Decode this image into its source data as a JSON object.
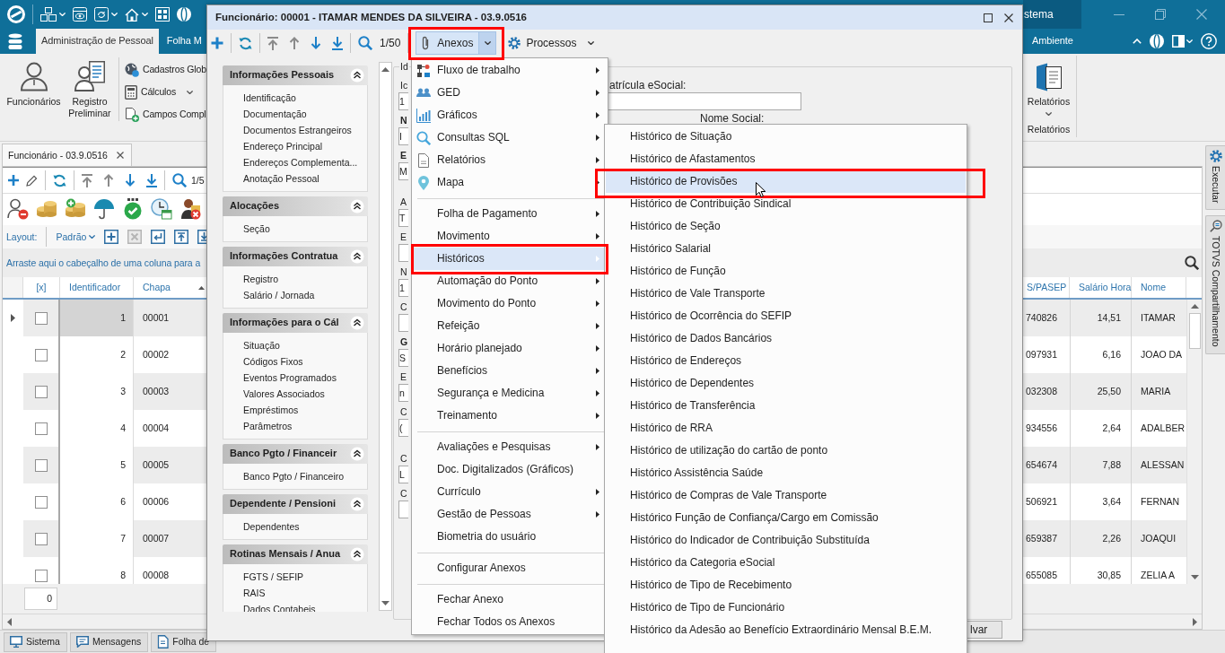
{
  "app_bar": {
    "title": "stema"
  },
  "ribbon": {
    "tabs": [
      {
        "label": "Administração de Pessoal",
        "selected": true
      },
      {
        "label": "Folha M",
        "selected": false
      },
      {
        "label": "Ambiente",
        "selected": false
      }
    ],
    "large_buttons": [
      {
        "label": "Funcionários"
      },
      {
        "label": "Registro Preliminar"
      }
    ],
    "small_buttons": [
      {
        "label": "Cadastros Glob"
      },
      {
        "label": "Cálculos",
        "dropdown": true
      },
      {
        "label": "Campos Compl"
      }
    ],
    "report_button": {
      "label": "Relatórios",
      "dropdown": true
    },
    "report_group": "Relatórios"
  },
  "document_tab": {
    "label": "Funcionário - 03.9.0516",
    "closable": true
  },
  "toolbar": {
    "position": "1/5"
  },
  "layout_bar": {
    "label": "Layout:",
    "value": "Padrão"
  },
  "group_hint": "Arraste aqui o cabeçalho de uma coluna para a",
  "grid": {
    "check_column": {
      "label": "[x]"
    },
    "columns": [
      {
        "label": "Identificador",
        "kind": "number",
        "sorted": false
      },
      {
        "label": "Chapa",
        "kind": "text",
        "sorted": true
      },
      {
        "label": "S/PASEP",
        "kind": "number",
        "sorted": false
      },
      {
        "label": "Salário Hora",
        "kind": "number",
        "sorted": false
      },
      {
        "label": "Nome",
        "kind": "text",
        "sorted": false
      }
    ],
    "rows": [
      {
        "selected": true,
        "checked": false,
        "cells": [
          "1",
          "00001",
          "740826",
          "14,51",
          "ITAMAR"
        ]
      },
      {
        "selected": false,
        "checked": false,
        "cells": [
          "2",
          "00002",
          "097931",
          "6,16",
          "JOAO DA"
        ]
      },
      {
        "selected": false,
        "checked": false,
        "cells": [
          "3",
          "00003",
          "032308",
          "25,50",
          "MARIA"
        ]
      },
      {
        "selected": false,
        "checked": false,
        "cells": [
          "4",
          "00004",
          "934556",
          "2,64",
          "ADALBER"
        ]
      },
      {
        "selected": false,
        "checked": false,
        "cells": [
          "5",
          "00005",
          "654674",
          "7,88",
          "ALESSAN"
        ]
      },
      {
        "selected": false,
        "checked": false,
        "cells": [
          "6",
          "00006",
          "506921",
          "3,64",
          "FERNAN"
        ]
      },
      {
        "selected": false,
        "checked": false,
        "cells": [
          "7",
          "00007",
          "659387",
          "2,26",
          "JOAQUI"
        ]
      },
      {
        "selected": false,
        "checked": false,
        "cells": [
          "8",
          "00008",
          "655085",
          "30,85",
          "ZELIA A"
        ]
      }
    ]
  },
  "grid_footer": {
    "count": "0"
  },
  "side_tabs": [
    {
      "label": "Executar"
    },
    {
      "label": "TOTVS Compartilhamento"
    }
  ],
  "taskbar": [
    {
      "label": "Sistema"
    },
    {
      "label": "Mensagens"
    },
    {
      "label": "Folha de"
    }
  ],
  "dialog": {
    "title": "Funcionário: 00001 - ITAMAR MENDES DA SILVEIRA - 03.9.0516",
    "position": "1/50",
    "menu_buttons": [
      {
        "label": "Anexos",
        "open": true,
        "framed": true
      },
      {
        "label": "Processos",
        "open": false,
        "framed": false
      }
    ],
    "sections": [
      {
        "title": "Informações Pessoais",
        "expanded": true,
        "links": [
          "Identificação",
          "Documentação",
          "Documentos Estrangeiros",
          "Endereço Principal",
          "Endereços Complementa...",
          "Anotação Pessoal"
        ]
      },
      {
        "title": "Alocações",
        "expanded": true,
        "links": [
          "Seção"
        ]
      },
      {
        "title": "Informações Contratua",
        "expanded": true,
        "links": [
          "Registro",
          "Salário / Jornada"
        ]
      },
      {
        "title": "Informações para o Cál",
        "expanded": true,
        "links": [
          "Situação",
          "Códigos Fixos",
          "Eventos Programados",
          "Valores Associados",
          "Empréstimos",
          "Parâmetros"
        ]
      },
      {
        "title": "Banco Pgto / Financeir",
        "expanded": true,
        "links": [
          "Banco Pgto / Financeiro"
        ]
      },
      {
        "title": "Dependente / Pensioni",
        "expanded": true,
        "links": [
          "Dependentes"
        ]
      },
      {
        "title": "Rotinas Mensais / Anua",
        "expanded": true,
        "links": [
          "FGTS / SEFIP",
          "RAIS",
          "Dados Contabeis"
        ]
      }
    ],
    "form": {
      "legend": "Id",
      "field_groups": [
        [
          {
            "label": "Ic",
            "value": "1",
            "required": false
          },
          {
            "label": "N",
            "value": "I",
            "required": true
          },
          {
            "label": "E",
            "value": "M",
            "required": true
          }
        ],
        [
          {
            "label": "A",
            "value": "T",
            "required": false
          },
          {
            "label": "E",
            "required": false
          },
          {
            "label": "N",
            "value": "1",
            "required": false
          },
          {
            "label": "C",
            "required": false
          },
          {
            "label": "G",
            "value": "S",
            "required": true
          },
          {
            "label": "E",
            "value": "n",
            "required": false
          },
          {
            "label": "C",
            "value": "(",
            "required": false
          }
        ],
        [
          {
            "label": "C",
            "value": "L",
            "required": false
          },
          {
            "label": "C",
            "required": false
          }
        ]
      ],
      "esocial_label": "atrícula eSocial:",
      "social_name_label": "Nome Social:"
    },
    "save_button": "lvar"
  },
  "attachments_menu": {
    "items": [
      {
        "kind": "icon_item",
        "label": "Fluxo de trabalho",
        "submenu": true,
        "selected": false,
        "framed": false
      },
      {
        "kind": "icon_item",
        "label": "GED",
        "submenu": true,
        "selected": false,
        "framed": false
      },
      {
        "kind": "icon_item",
        "label": "Gráficos",
        "submenu": true,
        "selected": false,
        "framed": false
      },
      {
        "kind": "icon_item",
        "label": "Consultas SQL",
        "submenu": true,
        "selected": false,
        "framed": false
      },
      {
        "kind": "icon_item",
        "label": "Relatórios",
        "submenu": true,
        "selected": false,
        "framed": false
      },
      {
        "kind": "icon_item",
        "label": "Mapa",
        "submenu": true,
        "selected": false,
        "framed": false
      },
      {
        "kind": "separator"
      },
      {
        "kind": "item",
        "label": "Folha de Pagamento",
        "submenu": true,
        "selected": false,
        "framed": false
      },
      {
        "kind": "item",
        "label": "Movimento",
        "submenu": true,
        "selected": false,
        "framed": false
      },
      {
        "kind": "item",
        "label": "Históricos",
        "submenu": true,
        "selected": true,
        "framed": true
      },
      {
        "kind": "item",
        "label": "Automação do Ponto",
        "submenu": true,
        "selected": false,
        "framed": false
      },
      {
        "kind": "item",
        "label": "Movimento do Ponto",
        "submenu": true,
        "selected": false,
        "framed": false
      },
      {
        "kind": "item",
        "label": "Refeição",
        "submenu": true,
        "selected": false,
        "framed": false
      },
      {
        "kind": "item",
        "label": "Horário planejado",
        "submenu": true,
        "selected": false,
        "framed": false
      },
      {
        "kind": "item",
        "label": "Benefícios",
        "submenu": true,
        "selected": false,
        "framed": false
      },
      {
        "kind": "item",
        "label": "Segurança e Medicina",
        "submenu": true,
        "selected": false,
        "framed": false
      },
      {
        "kind": "item",
        "label": "Treinamento",
        "submenu": true,
        "selected": false,
        "framed": false
      },
      {
        "kind": "separator"
      },
      {
        "kind": "item",
        "label": "Avaliações e Pesquisas",
        "submenu": true,
        "selected": false,
        "framed": false
      },
      {
        "kind": "item",
        "label": "Doc. Digitalizados (Gráficos)",
        "submenu": false,
        "selected": false,
        "framed": false
      },
      {
        "kind": "item",
        "label": "Currículo",
        "submenu": true,
        "selected": false,
        "framed": false
      },
      {
        "kind": "item",
        "label": "Gestão de Pessoas",
        "submenu": true,
        "selected": false,
        "framed": false
      },
      {
        "kind": "item",
        "label": "Biometria do usuário",
        "submenu": false,
        "selected": false,
        "framed": false
      },
      {
        "kind": "separator"
      },
      {
        "kind": "item",
        "label": "Configurar Anexos",
        "submenu": false,
        "selected": false,
        "framed": false
      },
      {
        "kind": "separator"
      },
      {
        "kind": "item",
        "label": "Fechar Anexo",
        "submenu": false,
        "selected": false,
        "framed": false
      },
      {
        "kind": "item",
        "label": "Fechar Todos os Anexos",
        "submenu": false,
        "selected": false,
        "framed": false
      }
    ]
  },
  "history_submenu": {
    "items": [
      {
        "label": "Histórico de Situação",
        "selected": false,
        "framed": false
      },
      {
        "label": "Histórico de Afastamentos",
        "selected": false,
        "framed": false
      },
      {
        "label": "Histórico de Provisões",
        "selected": true,
        "framed": true
      },
      {
        "label": "Histórico de Contribuição Sindical",
        "selected": false,
        "framed": false
      },
      {
        "label": "Histórico de Seção",
        "selected": false,
        "framed": false
      },
      {
        "label": "Histórico Salarial",
        "selected": false,
        "framed": false
      },
      {
        "label": "Histórico de Função",
        "selected": false,
        "framed": false
      },
      {
        "label": "Histórico de Vale Transporte",
        "selected": false,
        "framed": false
      },
      {
        "label": "Histórico de Ocorrência do SEFIP",
        "selected": false,
        "framed": false
      },
      {
        "label": "Histórico de Dados Bancários",
        "selected": false,
        "framed": false
      },
      {
        "label": "Histórico de Endereços",
        "selected": false,
        "framed": false
      },
      {
        "label": "Histórico de Dependentes",
        "selected": false,
        "framed": false
      },
      {
        "label": "Histórico de Transferência",
        "selected": false,
        "framed": false
      },
      {
        "label": "Histórico de RRA",
        "selected": false,
        "framed": false
      },
      {
        "label": "Histórico de utilização do cartão de ponto",
        "selected": false,
        "framed": false
      },
      {
        "label": "Histórico Assistência Saúde",
        "selected": false,
        "framed": false
      },
      {
        "label": "Histórico de Compras de Vale Transporte",
        "selected": false,
        "framed": false
      },
      {
        "label": "Histórico Função de Confiança/Cargo em Comissão",
        "selected": false,
        "framed": false
      },
      {
        "label": "Histórico do Indicador de Contribuição Substituída",
        "selected": false,
        "framed": false
      },
      {
        "label": "Histórico da Categoria eSocial",
        "selected": false,
        "framed": false
      },
      {
        "label": "Histórico de Tipo de Recebimento",
        "selected": false,
        "framed": false
      },
      {
        "label": "Histórico de Tipo de Funcionário",
        "selected": false,
        "framed": false
      },
      {
        "label": "Histórico da Adesão ao Benefício Extraordinário Mensal B.E.M.",
        "selected": false,
        "framed": false
      }
    ]
  }
}
